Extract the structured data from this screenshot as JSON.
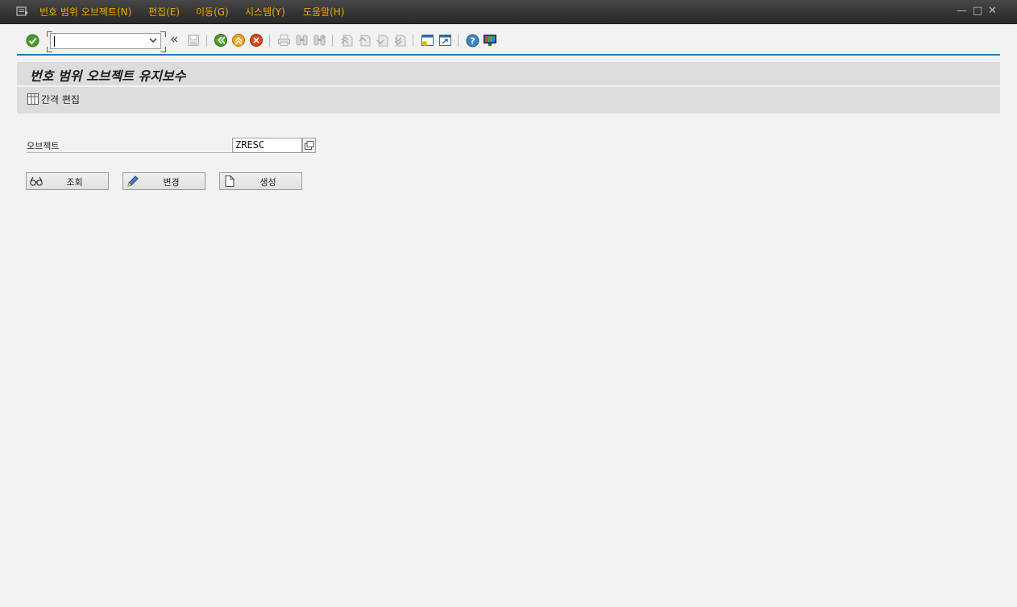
{
  "menubar": {
    "items": [
      {
        "label": "번호 범위 오브젝트(N)"
      },
      {
        "label": "편집(E)"
      },
      {
        "label": "이동(G)"
      },
      {
        "label": "시스템(Y)"
      },
      {
        "label": "도움말(H)"
      }
    ],
    "window_buttons": {
      "minimize": "—",
      "restore": "□",
      "close": "✕"
    }
  },
  "toolbar": {
    "command_field": {
      "value": ""
    },
    "collapse_glyph": "«",
    "icons": [
      "enter-icon",
      "save-icon",
      "back-icon",
      "exit-icon",
      "cancel-icon",
      "print-icon",
      "find-icon",
      "find-next-icon",
      "first-page-icon",
      "previous-page-icon",
      "next-page-icon",
      "last-page-icon",
      "new-session-icon",
      "shortcut-icon",
      "help-icon",
      "layout-menu-icon"
    ]
  },
  "page": {
    "title": "번호 범위 오브젝트 유지보수",
    "app_toolbar": {
      "interval_edit_label": "간격 편집"
    }
  },
  "form": {
    "object": {
      "label": "오브젝트",
      "value": "ZRESC"
    }
  },
  "buttons": {
    "display_label": "조회",
    "change_label": "변경",
    "create_label": "생성"
  },
  "colors": {
    "menu_text": "#f0ab00",
    "accent_rule": "#2a7aa8",
    "panel_bg": "#dcdcdc",
    "page_bg": "#f2f2f2"
  }
}
